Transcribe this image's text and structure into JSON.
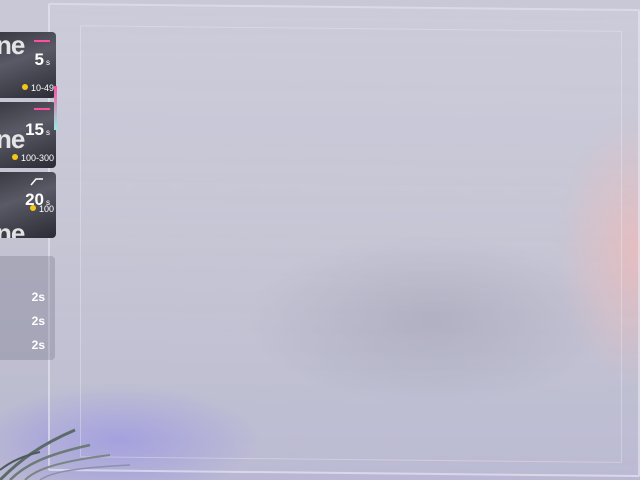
{
  "tip_menu": {
    "items": [
      {
        "bg_word": "ne",
        "duration": "5",
        "unit": "s",
        "range": "10-49"
      },
      {
        "bg_word": "ne",
        "duration": "15",
        "unit": "s",
        "range": "100-300"
      },
      {
        "bg_word": "ne",
        "duration": "20",
        "unit": "s",
        "range": "100"
      }
    ],
    "accent_colors": [
      "#ff4da6",
      "#8cf2e0"
    ],
    "coin_color": "#f5c518"
  },
  "queue": {
    "items": [
      {
        "duration": "2s"
      },
      {
        "duration": "2s"
      },
      {
        "duration": "2s"
      }
    ]
  }
}
